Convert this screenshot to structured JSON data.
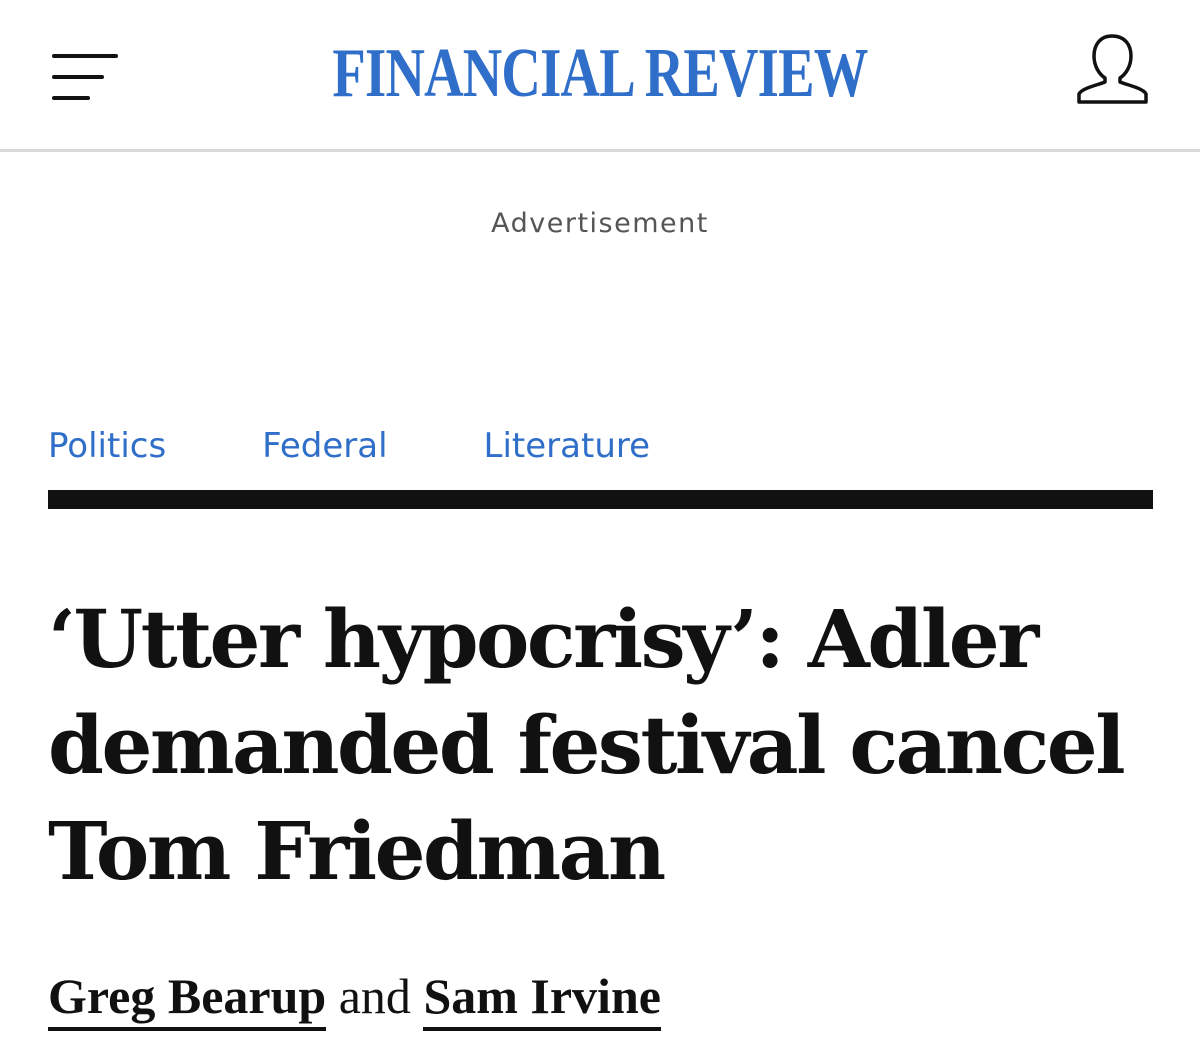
{
  "header": {
    "logo_text": "FINANCIAL REVIEW",
    "menu_icon": "hamburger-menu-icon",
    "account_icon": "user-account-icon",
    "brand_color": "#2f6ec9"
  },
  "advertisement": {
    "label": "Advertisement"
  },
  "tags": [
    {
      "label": "Politics"
    },
    {
      "label": "Federal"
    },
    {
      "label": "Literature"
    }
  ],
  "article": {
    "headline": "‘Utter hypocrisy’: Adler demanded festival cancel Tom Friedman",
    "byline": {
      "authors": [
        "Greg Bearup",
        "Sam Irvine"
      ],
      "conjunction": "and"
    }
  }
}
